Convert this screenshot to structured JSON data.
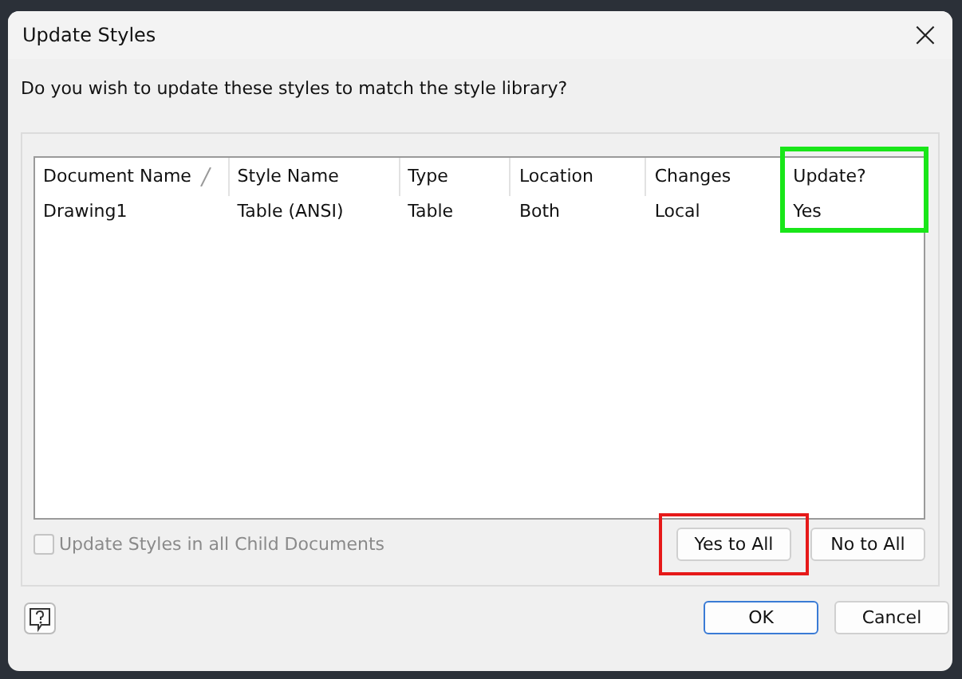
{
  "window": {
    "title": "Update Styles",
    "close": "×"
  },
  "prompt": "Do you wish to update these styles to match the style library?",
  "table": {
    "columns": [
      {
        "label": "Document Name",
        "sorted": true
      },
      {
        "label": "Style Name",
        "sorted": false
      },
      {
        "label": "Type",
        "sorted": false
      },
      {
        "label": "Location",
        "sorted": false
      },
      {
        "label": "Changes",
        "sorted": false
      },
      {
        "label": "Update?",
        "sorted": false,
        "color": "#19e619"
      }
    ],
    "rows": [
      [
        "Drawing1",
        "Table (ANSI)",
        "Table",
        "Both",
        "Local",
        "Yes"
      ]
    ]
  },
  "child_option": {
    "label": "Update Styles in all Child Documents",
    "checked": false,
    "disabled": true
  },
  "buttons": [
    {
      "label": "Yes to All",
      "color": "#e61919"
    },
    {
      "label": "No to All"
    }
  ],
  "footer_buttons": [
    {
      "label": "OK",
      "default": true
    },
    {
      "label": "Cancel",
      "default": false
    }
  ]
}
